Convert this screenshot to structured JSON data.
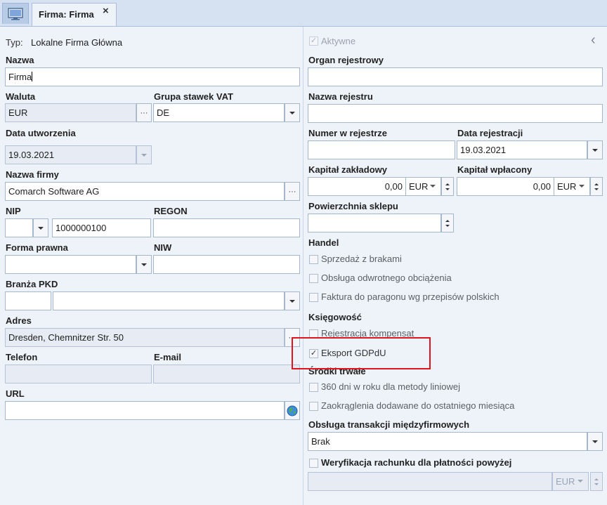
{
  "tabs": {
    "label": "Firma: Firma",
    "close": "×"
  },
  "typ": {
    "label": "Typ:",
    "value": "Lokalne Firma Główna"
  },
  "aktywne": {
    "label": "Aktywne",
    "checked": true
  },
  "collapse": "‹",
  "nazwa": {
    "label": "Nazwa",
    "value": "Firma"
  },
  "waluta": {
    "label": "Waluta",
    "value": "EUR",
    "btn": "···"
  },
  "grupa_vat": {
    "label": "Grupa stawek VAT",
    "value": "DE"
  },
  "data_utworzenia": {
    "label": "Data utworzenia",
    "value": "19.03.2021"
  },
  "nazwa_firmy": {
    "label": "Nazwa firmy",
    "value": "Comarch Software AG",
    "btn": "···"
  },
  "nip": {
    "label": "NIP",
    "prefix": "",
    "value": "1000000100"
  },
  "regon": {
    "label": "REGON",
    "value": ""
  },
  "forma_prawna": {
    "label": "Forma prawna",
    "value": ""
  },
  "niw": {
    "label": "NIW",
    "value": ""
  },
  "branza": {
    "label": "Branża PKD",
    "code": "",
    "value": ""
  },
  "adres": {
    "label": "Adres",
    "value": "Dresden, Chemnitzer Str. 50",
    "btn": "···"
  },
  "telefon": {
    "label": "Telefon",
    "value": ""
  },
  "email": {
    "label": "E-mail",
    "value": ""
  },
  "url": {
    "label": "URL",
    "value": ""
  },
  "organ": {
    "label": "Organ rejestrowy",
    "value": ""
  },
  "nazwa_rejestru": {
    "label": "Nazwa rejestru",
    "value": ""
  },
  "numer_rejestr": {
    "label": "Numer w rejestrze",
    "value": ""
  },
  "data_rejestracji": {
    "label": "Data rejestracji",
    "value": "19.03.2021"
  },
  "kapital_zakl": {
    "label": "Kapitał zakładowy",
    "value": "0,00",
    "currency": "EUR"
  },
  "kapital_wpl": {
    "label": "Kapitał wpłacony",
    "value": "0,00",
    "currency": "EUR"
  },
  "powierzchnia": {
    "label": "Powierzchnia sklepu",
    "value": ""
  },
  "handel": {
    "label": "Handel",
    "items": [
      "Sprzedaż z brakami",
      "Obsługa odwrotnego obciążenia",
      "Faktura do paragonu wg przepisów polskich"
    ]
  },
  "ksiegowosc": {
    "label": "Księgowość",
    "items": [
      "Rejestracja kompensat",
      "Eksport GDPdU"
    ]
  },
  "srodki": {
    "label": "Środki trwałe",
    "items": [
      "360 dni w roku dla metody liniowej",
      "Zaokrąglenia dodawane do ostatniego miesiąca"
    ]
  },
  "transakcje": {
    "label": "Obsługa transakcji międzyfirmowych",
    "value": "Brak"
  },
  "weryfikacja": {
    "label": "Weryfikacja rachunku dla płatności powyżej",
    "value": "",
    "currency": "EUR"
  },
  "colors": {
    "accent_border": "#a5b6cf",
    "panel_bg": "#eef3fa",
    "highlight": "#e0141e"
  }
}
